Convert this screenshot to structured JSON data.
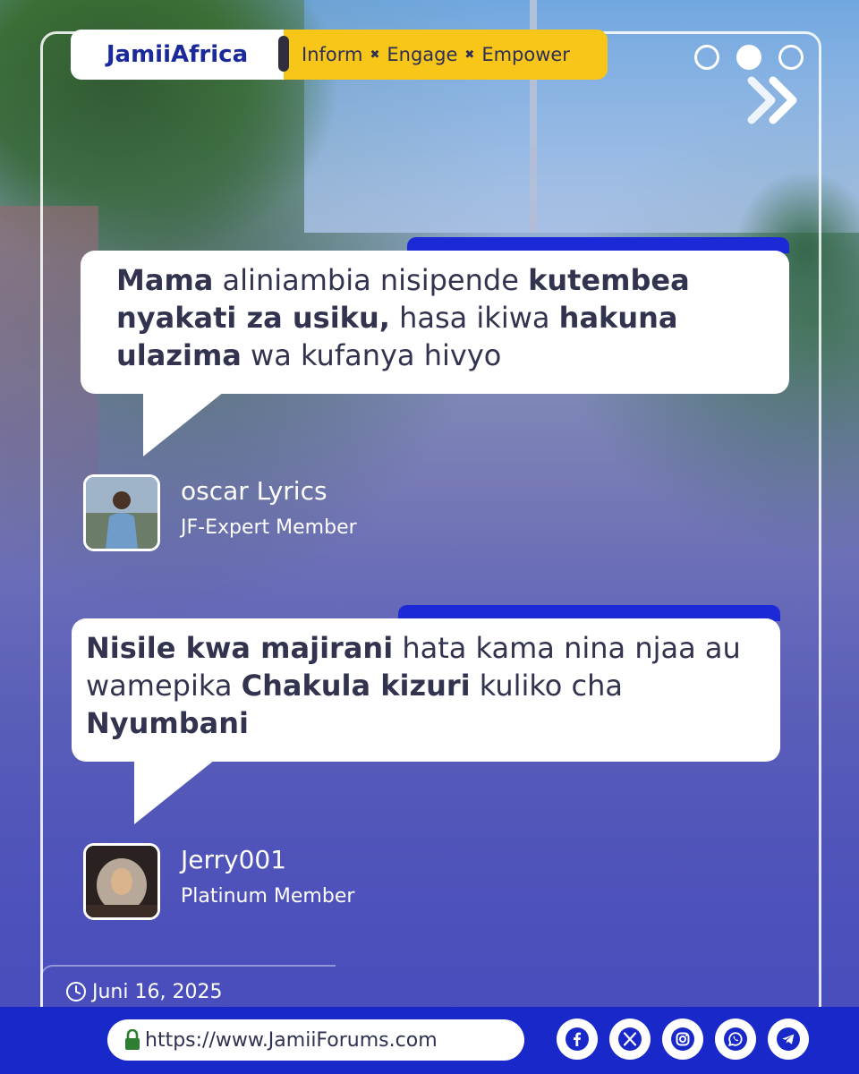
{
  "header": {
    "brand_part1": "Jamii",
    "brand_part2": "Africa",
    "tag_1": "Inform",
    "tag_2": "Engage",
    "tag_3": "Empower",
    "tag_separator": "✖",
    "carousel_dots": [
      "inactive",
      "active",
      "inactive"
    ]
  },
  "posts": [
    {
      "segments": [
        {
          "text": "Mama",
          "bold": true
        },
        {
          "text": " aliniambia nisipende ",
          "bold": false
        },
        {
          "text": "kutembea nyakati za usiku,",
          "bold": true
        },
        {
          "text": " hasa ikiwa ",
          "bold": false
        },
        {
          "text": "hakuna ulazima",
          "bold": true
        },
        {
          "text": " wa kufanya hivyo",
          "bold": false
        }
      ],
      "author": "oscar Lyrics",
      "role": "JF-Expert Member"
    },
    {
      "segments": [
        {
          "text": "Nisile kwa majirani",
          "bold": true
        },
        {
          "text": " hata kama nina njaa au wamepika ",
          "bold": false
        },
        {
          "text": "Chakula kizuri",
          "bold": true
        },
        {
          "text": " kuliko cha ",
          "bold": false
        },
        {
          "text": "Nyumbani",
          "bold": true
        }
      ],
      "author": "Jerry001",
      "role": "Platinum Member"
    }
  ],
  "date": "Juni 16, 2025",
  "footer": {
    "url": "https://www.JamiiForums.com",
    "socials": [
      "facebook-icon",
      "x-icon",
      "instagram-icon",
      "whatsapp-icon",
      "telegram-icon"
    ]
  },
  "colors": {
    "brand_blue": "#1929c9",
    "tag_yellow": "#f7c619",
    "accent_bar": "#1b2ad6",
    "text_dark": "#32344f"
  }
}
